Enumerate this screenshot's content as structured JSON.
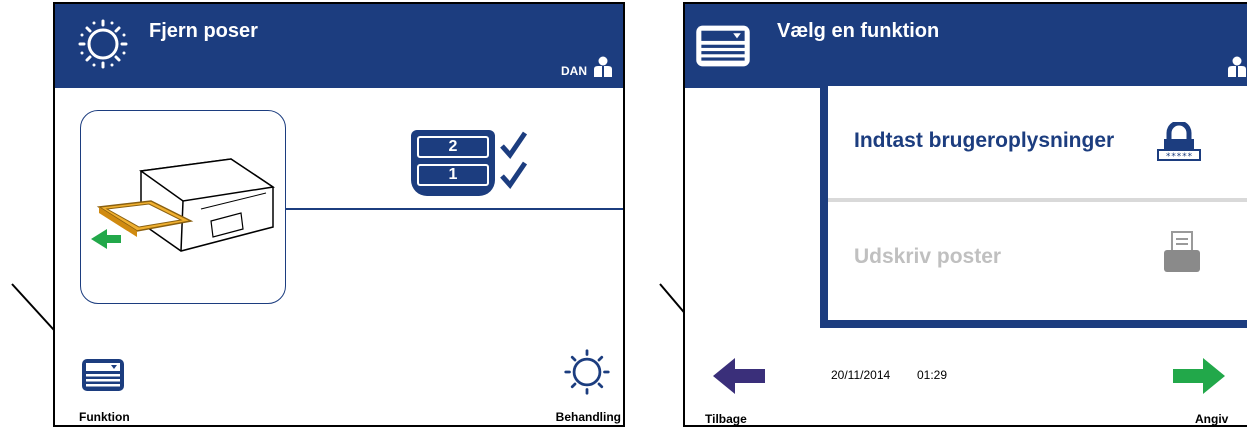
{
  "left_screen": {
    "title": "Fjern poser",
    "title_icon": "sun-processing-icon",
    "user": "DAN",
    "user_icon": "user-icon",
    "rack": {
      "levels": [
        "2",
        "1"
      ],
      "check_icon": "checkmark-icon"
    },
    "illustration_icon": "instrument-drawer-out-icon",
    "footer": {
      "left_label": "Funktion",
      "left_icon": "function-menu-icon",
      "right_label": "Behandling",
      "right_icon": "sun-processing-icon"
    }
  },
  "right_screen": {
    "title": "Vælg en funktion",
    "title_icon": "function-menu-icon",
    "user_icon": "user-icon",
    "menu": [
      {
        "label": "Indtast brugeroplysninger",
        "icon": "lock-icon",
        "enabled": true
      },
      {
        "label": "Udskriv poster",
        "icon": "printer-icon",
        "enabled": false
      }
    ],
    "footer": {
      "back_label": "Tilbage",
      "back_icon": "arrow-left-icon",
      "date": "20/11/2014",
      "time": "01:29",
      "next_label": "Angiv",
      "next_icon": "arrow-right-icon"
    }
  },
  "colors": {
    "navy": "#1c3d7f",
    "green": "#22a84a",
    "disabled": "#c0c0c0",
    "tray": "#f0b030",
    "divider": "#d9d9d9"
  }
}
